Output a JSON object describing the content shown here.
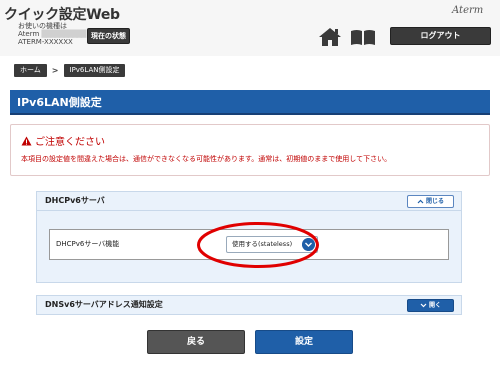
{
  "header": {
    "app_title": "クイック設定Web",
    "model_label": "お使いの機種は",
    "model_value_prefix": "Aterm",
    "model_value_masked": "██████████",
    "model_id": "ATERM-XXXXXX",
    "status_button": "現在の状態",
    "brand": "Aterm",
    "home_icon": "home-icon",
    "manual_icon": "book-icon",
    "logout_button": "ログアウト"
  },
  "breadcrumb": {
    "home": "ホーム",
    "separator": ">",
    "current": "IPv6LAN側設定"
  },
  "page": {
    "title": "IPv6LAN側設定"
  },
  "caution": {
    "title": "ご注意ください",
    "text": "本項目の設定値を間違えた場合は、通信ができなくなる可能性があります。通常は、初期値のままで使用して下さい。",
    "icon": "warning-icon"
  },
  "sections": {
    "dhcpv6": {
      "title": "DHCPv6サーバ",
      "toggle_label": "閉じる",
      "field_label": "DHCPv6サーバ機能",
      "select_value": "使用する(stateless)"
    },
    "dnsv6": {
      "title": "DNSv6サーバアドレス通知設定",
      "toggle_label": "開く"
    }
  },
  "actions": {
    "back": "戻る",
    "set": "設定"
  },
  "colors": {
    "primary": "#1f5fa8",
    "dark_button": "#3a3a3a",
    "caution": "#c00000",
    "section_bg": "#eaf2fb",
    "annotation": "#e00000"
  }
}
